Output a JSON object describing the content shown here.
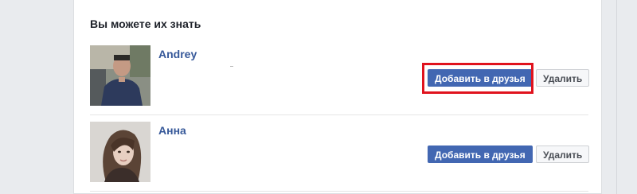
{
  "card": {
    "title": "Вы можете их знать"
  },
  "people": [
    {
      "name": "Andrey",
      "add_label": "Добавить в друзья",
      "remove_label": "Удалить"
    },
    {
      "name": "Анна",
      "add_label": "Добавить в друзья",
      "remove_label": "Удалить"
    }
  ],
  "colors": {
    "accent": "#4267b2",
    "link": "#365899",
    "highlight": "#e0131e"
  }
}
